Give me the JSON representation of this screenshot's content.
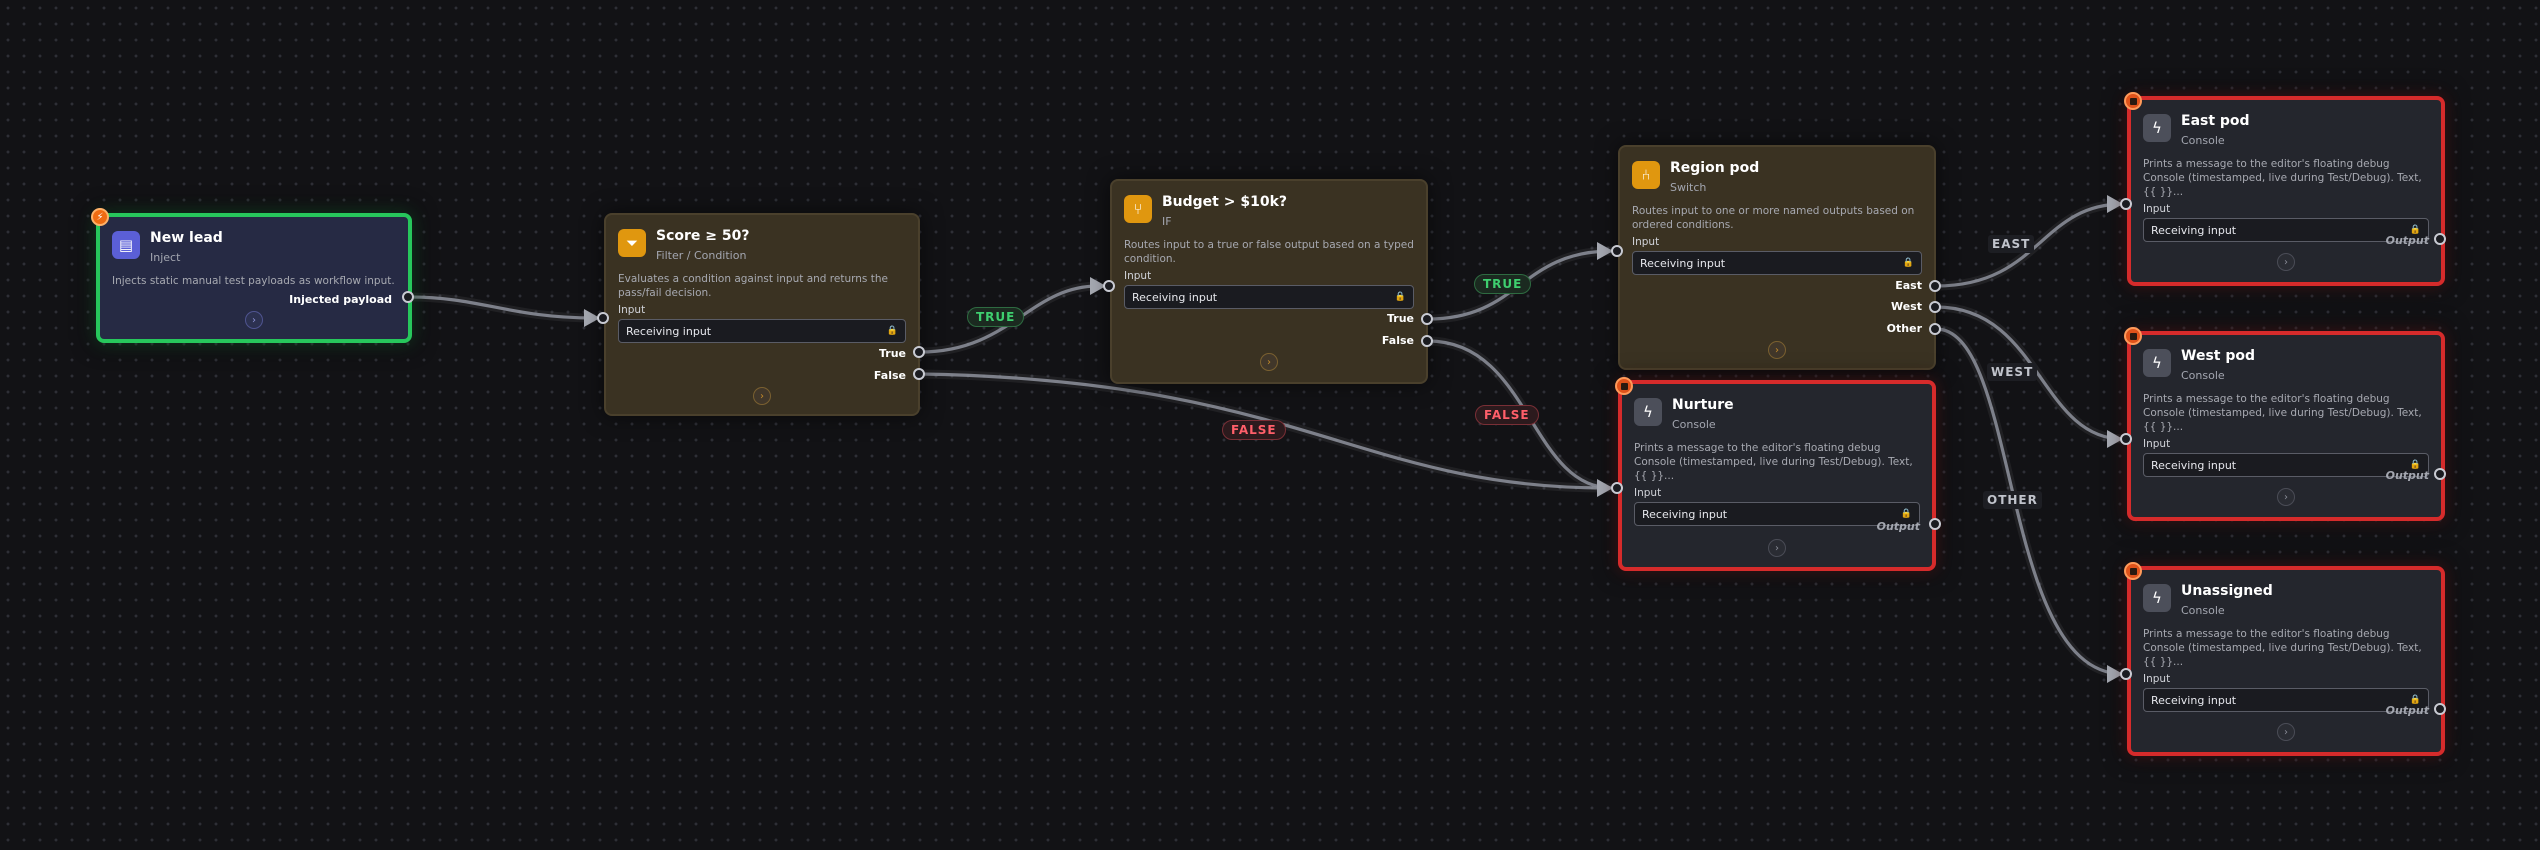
{
  "colors": {
    "inject_border": "#27c75c",
    "console_border": "#d62b2b",
    "logic_bg": "#3a3222",
    "true_label": "#3ecf6f",
    "false_label": "#ff5f6a",
    "badge": "#ef6b12"
  },
  "nodes": {
    "new_lead": {
      "title": "New lead",
      "type": "Inject",
      "icon": "document-icon",
      "description": "Injects static manual test payloads as workflow input.",
      "output_label": "Injected payload"
    },
    "score": {
      "title": "Score ≥ 50?",
      "type": "Filter / Condition",
      "icon": "filter-icon",
      "description": "Evaluates a condition against input and returns the pass/fail decision.",
      "input_label": "Input",
      "input_value": "Receiving input",
      "outputs": [
        "True",
        "False"
      ]
    },
    "budget": {
      "title": "Budget > $10k?",
      "type": "IF",
      "icon": "branch-icon",
      "description": "Routes input to a true or false output based on a typed condition.",
      "input_label": "Input",
      "input_value": "Receiving input",
      "outputs": [
        "True",
        "False"
      ]
    },
    "region": {
      "title": "Region pod",
      "type": "Switch",
      "icon": "switch-icon",
      "description": "Routes input to one or more named outputs based on ordered conditions.",
      "input_label": "Input",
      "input_value": "Receiving input",
      "outputs": [
        "East",
        "West",
        "Other"
      ]
    },
    "nurture": {
      "title": "Nurture",
      "type": "Console",
      "icon": "bolt-icon",
      "description": "Prints a message to the editor's floating debug Console (timestamped, live during Test/Debug). Text, {{ }}...",
      "input_label": "Input",
      "input_value": "Receiving input",
      "output_label": "Output"
    },
    "east": {
      "title": "East pod",
      "type": "Console",
      "icon": "bolt-icon",
      "description": "Prints a message to the editor's floating debug Console (timestamped, live during Test/Debug). Text, {{ }}...",
      "input_label": "Input",
      "input_value": "Receiving input",
      "output_label": "Output"
    },
    "west": {
      "title": "West pod",
      "type": "Console",
      "icon": "bolt-icon",
      "description": "Prints a message to the editor's floating debug Console (timestamped, live during Test/Debug). Text, {{ }}...",
      "input_label": "Input",
      "input_value": "Receiving input",
      "output_label": "Output"
    },
    "unassigned": {
      "title": "Unassigned",
      "type": "Console",
      "icon": "bolt-icon",
      "description": "Prints a message to the editor's floating debug Console (timestamped, live during Test/Debug). Text, {{ }}...",
      "input_label": "Input",
      "input_value": "Receiving input",
      "output_label": "Output"
    }
  },
  "edge_labels": {
    "score_true": "TRUE",
    "score_false": "FALSE",
    "budget_true": "TRUE",
    "budget_false": "FALSE",
    "east": "EAST",
    "west": "WEST",
    "other": "OTHER"
  }
}
